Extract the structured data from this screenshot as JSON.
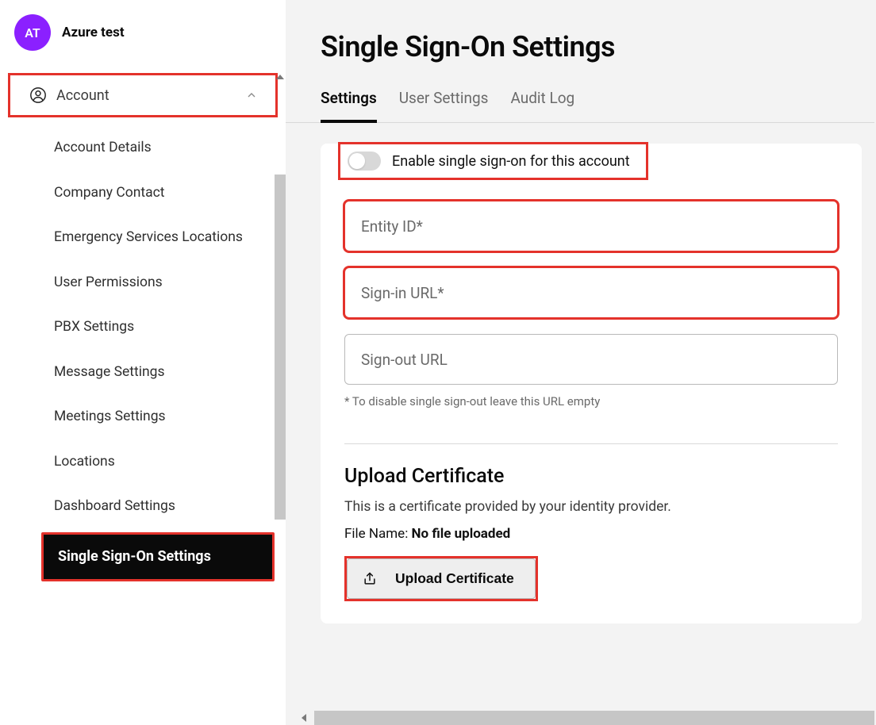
{
  "header": {
    "avatar_initials": "AT",
    "account_name": "Azure test"
  },
  "sidebar": {
    "section_label": "Account",
    "items": [
      {
        "label": "Account Details"
      },
      {
        "label": "Company Contact"
      },
      {
        "label": "Emergency Services Locations"
      },
      {
        "label": "User Permissions"
      },
      {
        "label": "PBX Settings"
      },
      {
        "label": "Message Settings"
      },
      {
        "label": "Meetings Settings"
      },
      {
        "label": "Locations"
      },
      {
        "label": "Dashboard Settings"
      },
      {
        "label": "Single Sign-On Settings"
      }
    ]
  },
  "page": {
    "title": "Single Sign-On Settings",
    "tabs": [
      {
        "label": "Settings"
      },
      {
        "label": "User Settings"
      },
      {
        "label": "Audit Log"
      }
    ],
    "toggle_label": "Enable single sign-on for this account",
    "fields": {
      "entity_id_placeholder": "Entity ID*",
      "signin_url_placeholder": "Sign-in URL*",
      "signout_url_placeholder": "Sign-out URL",
      "signout_hint": "* To disable single sign-out leave this URL empty"
    },
    "upload": {
      "title": "Upload Certificate",
      "description": "This is a certificate provided by your identity provider.",
      "file_name_label": "File Name:",
      "file_name_value": "No file uploaded",
      "button_label": "Upload Certificate"
    }
  },
  "colors": {
    "accent_purple": "#8B20FF",
    "highlight_red": "#E4322B"
  }
}
